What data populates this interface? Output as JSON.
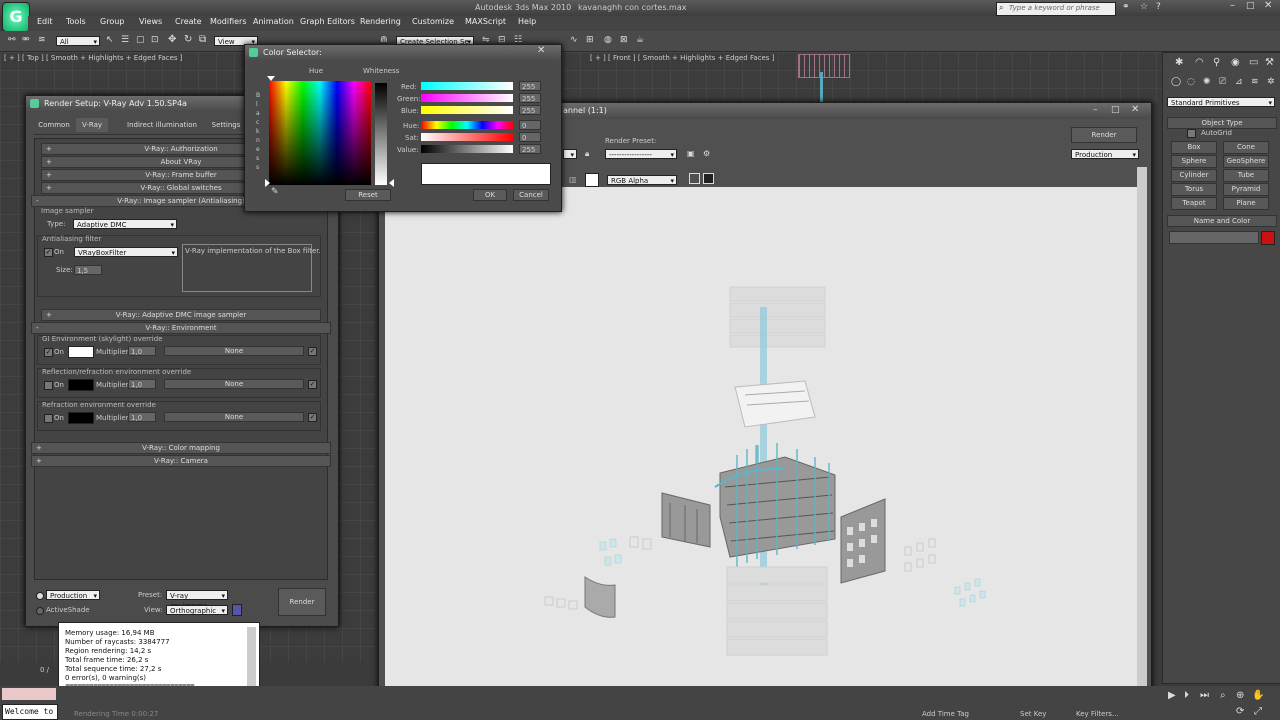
{
  "app": {
    "title": "Autodesk 3ds Max  2010",
    "file": "kavanaghh con cortes.max",
    "search_placeholder": "Type a keyword or phrase"
  },
  "menu": [
    "Edit",
    "Tools",
    "Group",
    "Views",
    "Create",
    "Modifiers",
    "Animation",
    "Graph Editors",
    "Rendering",
    "Customize",
    "MAXScript",
    "Help"
  ],
  "toolbar": {
    "filter": "All",
    "coord": "View",
    "selection_set": "Create Selection Se"
  },
  "viewports": {
    "top_label": "[ + ] [ Top ] [ Smooth + Highlights + Edged Faces ]",
    "front_label": "[ + ] [ Front ] [ Smooth + Highlights + Edged Faces ]"
  },
  "render_setup": {
    "title": "Render Setup: V-Ray Adv 1.50.SP4a",
    "tabs": [
      "Common",
      "V-Ray",
      "Indirect illumination",
      "Settings"
    ],
    "rollouts_top": [
      "V-Ray:: Authorization",
      "About VRay",
      "V-Ray:: Frame buffer",
      "V-Ray:: Global switches",
      "V-Ray:: Image sampler (Antialiasing)"
    ],
    "image_sampler": {
      "group": "Image sampler",
      "type_label": "Type:",
      "type_value": "Adaptive DMC"
    },
    "aa_filter": {
      "group": "Antialiasing filter",
      "on_label": "On",
      "filter_value": "VRayBoxFilter",
      "description": "V-Ray implementation of the Box filter.",
      "size_label": "Size:",
      "size_value": "1,5"
    },
    "rollout_adaptive": "V-Ray:: Adaptive DMC image sampler",
    "rollout_environment": "V-Ray:: Environment",
    "env_groups": [
      {
        "title": "GI Environment (skylight) override",
        "on": "On",
        "mult_label": "Multiplier:",
        "mult": "1,0",
        "map": "None",
        "swatch": "#ffffff"
      },
      {
        "title": "Reflection/refraction environment override",
        "on": "On",
        "mult_label": "Multiplier:",
        "mult": "1,0",
        "map": "None",
        "swatch": "#000000"
      },
      {
        "title": "Refraction environment override",
        "on": "On",
        "mult_label": "Multiplier:",
        "mult": "1,0",
        "map": "None",
        "swatch": "#000000"
      }
    ],
    "rollouts_bottom": [
      "V-Ray:: Color mapping",
      "V-Ray:: Camera"
    ],
    "footer": {
      "production": "Production",
      "activeshade": "ActiveShade",
      "preset_label": "Preset:",
      "preset_value": "V-ray environme",
      "view_label": "View:",
      "view_value": "Orthographic",
      "render": "Render"
    }
  },
  "color_selector": {
    "title": "Color Selector:",
    "hue_label": "Hue",
    "whiteness_label": "Whiteness",
    "blackness_label": "B l a c k n e s s",
    "channels": [
      {
        "label": "Red:",
        "value": "255"
      },
      {
        "label": "Green:",
        "value": "255"
      },
      {
        "label": "Blue:",
        "value": "255"
      },
      {
        "label": "Hue:",
        "value": "0"
      },
      {
        "label": "Sat:",
        "value": "0"
      },
      {
        "label": "Value:",
        "value": "255"
      }
    ],
    "reset": "Reset",
    "ok": "OK",
    "cancel": "Cancel",
    "current_color": "#ffffff"
  },
  "frame_window": {
    "title": "annel (1:1)",
    "render_preset_label": "Render Preset:",
    "render_button": "Render",
    "production": "Production",
    "channel": "RGB Alpha"
  },
  "command_panel": {
    "dropdown": "Standard Primitives",
    "object_type": "Object Type",
    "autogrid": "AutoGrid",
    "buttons": [
      "Box",
      "Cone",
      "Sphere",
      "GeoSphere",
      "Cylinder",
      "Tube",
      "Torus",
      "Pyramid",
      "Teapot",
      "Plane"
    ],
    "name_and_color": "Name and Color",
    "color": "#cc1111"
  },
  "log": {
    "lines": [
      "Memory usage: 16,94 MB",
      "Number of raycasts: 3384777",
      "Region rendering: 14,2 s",
      "Total frame time: 26,2 s",
      "Total sequence time: 27,2 s",
      "0 error(s), 0 warning(s)",
      "================================"
    ]
  },
  "status": {
    "welcome": "Welcome to",
    "rendering_time": "Rendering Time  0:00:27",
    "add_time_tag": "Add Time Tag",
    "set_key": "Set Key",
    "key_filters": "Key Filters...",
    "frame_counter": "0 /"
  }
}
